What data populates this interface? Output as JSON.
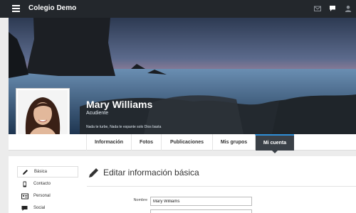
{
  "app": {
    "title": "Colegio Demo"
  },
  "topbar": {
    "icons": [
      "mail-icon",
      "chat-icon",
      "user-icon"
    ]
  },
  "profile": {
    "name": "Mary Williams",
    "role": "Acudiente",
    "quote": "Nada te turbe, Nada te espante solo Dios basta"
  },
  "tabs": [
    {
      "label": "Información",
      "active": false
    },
    {
      "label": "Fotos",
      "active": false
    },
    {
      "label": "Publicaciones",
      "active": false
    },
    {
      "label": "Mis grupos",
      "active": false
    },
    {
      "label": "Mi cuenta",
      "active": true
    }
  ],
  "sidebar": {
    "items": [
      {
        "label": "Básica",
        "icon": "pencil-icon",
        "active": true
      },
      {
        "label": "Contacto",
        "icon": "phone-icon",
        "active": false
      },
      {
        "label": "Personal",
        "icon": "id-card-icon",
        "active": false
      },
      {
        "label": "Social",
        "icon": "comment-icon",
        "active": false
      }
    ]
  },
  "form": {
    "title": "Editar información básica",
    "fields": [
      {
        "label": "Nombre",
        "value": "Mary Williams"
      }
    ]
  },
  "colors": {
    "topbar": "#23272c",
    "accent": "#2f8fd8",
    "active_tab": "#3a4047"
  }
}
